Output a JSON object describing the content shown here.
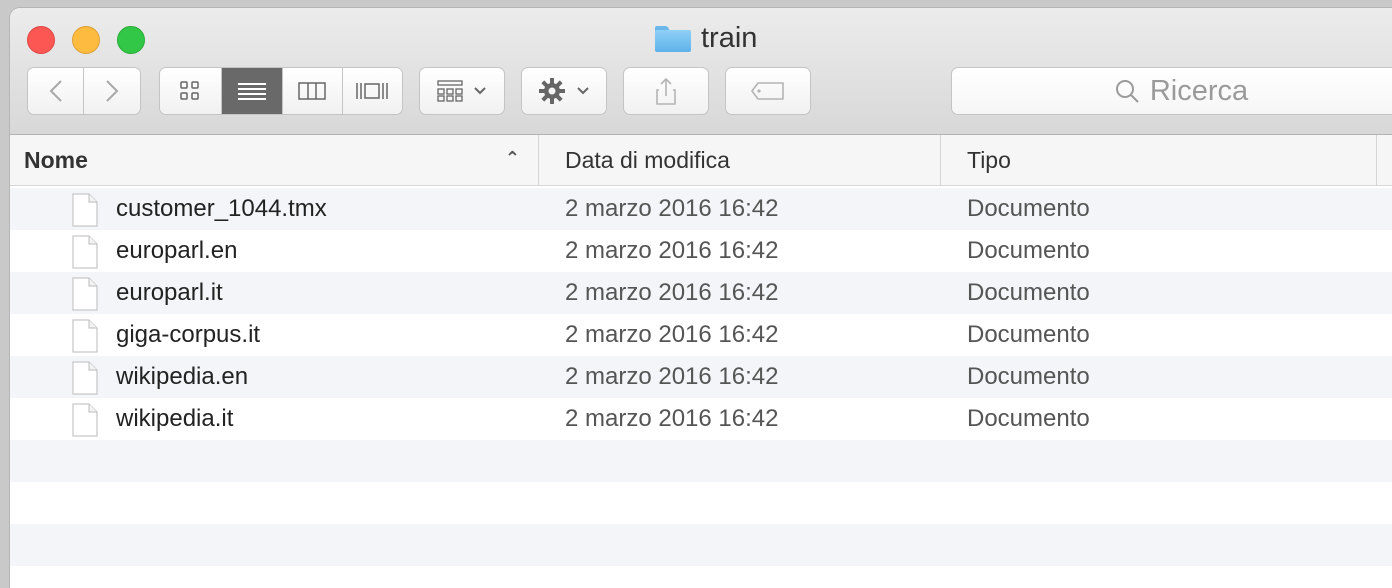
{
  "window": {
    "title": "train"
  },
  "toolbar": {
    "back_icon": "chevron-left-icon",
    "forward_icon": "chevron-right-icon",
    "view_modes": [
      "icon-view-icon",
      "list-view-icon",
      "column-view-icon",
      "coverflow-view-icon"
    ],
    "active_view": "list",
    "search_placeholder": "Ricerca"
  },
  "columns": {
    "name": "Nome",
    "date": "Data di modifica",
    "type": "Tipo"
  },
  "files": [
    {
      "name": "customer_1044.tmx",
      "date": "2 marzo 2016 16:42",
      "type": "Documento"
    },
    {
      "name": "europarl.en",
      "date": "2 marzo 2016 16:42",
      "type": "Documento"
    },
    {
      "name": "europarl.it",
      "date": "2 marzo 2016 16:42",
      "type": "Documento"
    },
    {
      "name": "giga-corpus.it",
      "date": "2 marzo 2016 16:42",
      "type": "Documento"
    },
    {
      "name": "wikipedia.en",
      "date": "2 marzo 2016 16:42",
      "type": "Documento"
    },
    {
      "name": "wikipedia.it",
      "date": "2 marzo 2016 16:42",
      "type": "Documento"
    }
  ],
  "colors": {
    "close": "#fc5753",
    "minimize": "#fdbc40",
    "zoom": "#33c748",
    "row_alt": "#f3f5f8"
  }
}
